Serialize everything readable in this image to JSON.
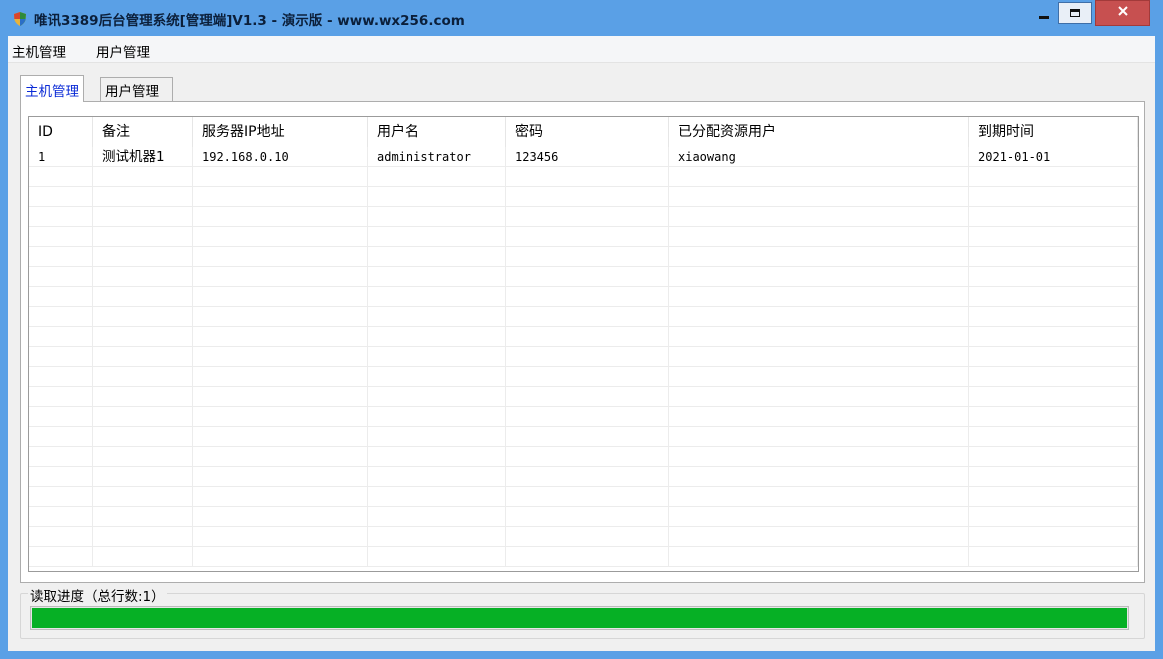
{
  "window": {
    "title": "唯讯3389后台管理系统[管理端]V1.3 - 演示版 - www.wx256.com",
    "title_color": "#5aa0e6",
    "close_color": "#c75050"
  },
  "menubar": {
    "items": [
      {
        "label": "主机管理"
      },
      {
        "label": "用户管理"
      }
    ]
  },
  "tabs": [
    {
      "label": "主机管理",
      "active": true
    },
    {
      "label": "用户管理",
      "active": false
    }
  ],
  "table": {
    "columns": [
      "ID",
      "备注",
      "服务器IP地址",
      "用户名",
      "密码",
      "已分配资源用户",
      "到期时间"
    ],
    "rows": [
      [
        "1",
        "测试机器1",
        "192.168.0.10",
        "administrator",
        "123456",
        "xiaowang",
        "2021-01-01"
      ]
    ]
  },
  "progress": {
    "label": "读取进度（总行数:1）",
    "value": 1.0,
    "fill_color": "#06b025"
  }
}
